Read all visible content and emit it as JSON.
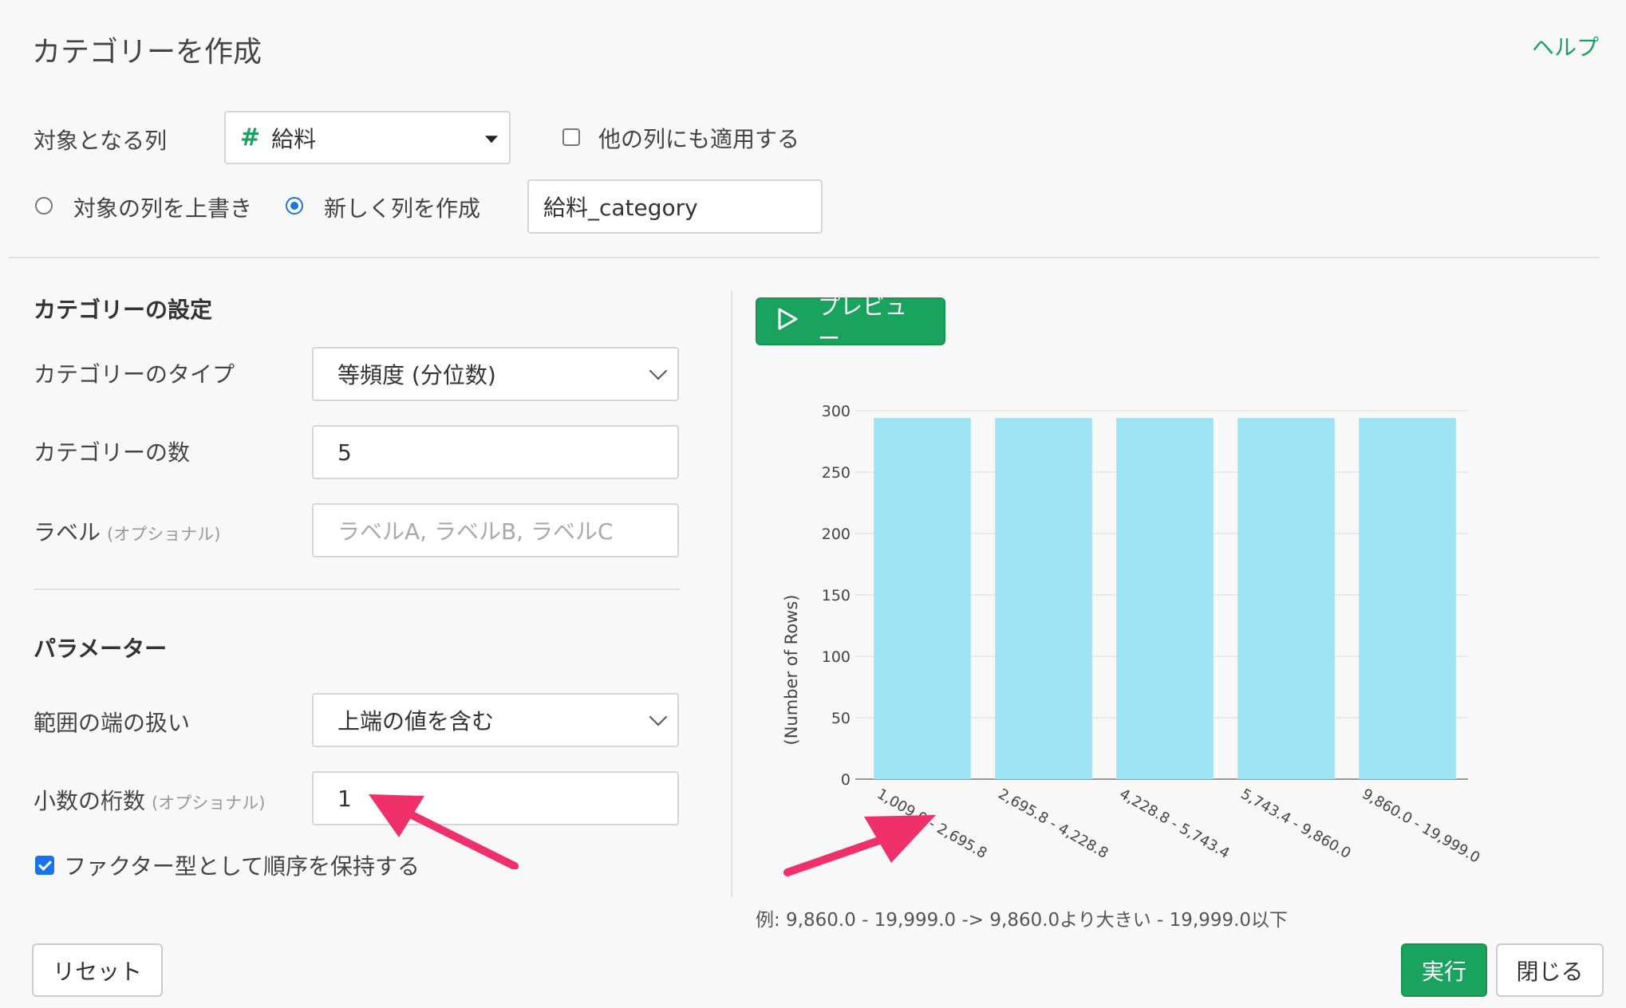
{
  "dialog": {
    "title": "カテゴリーを作成",
    "help": "ヘルプ"
  },
  "target": {
    "label": "対象となる列",
    "column": "給料",
    "column_type_icon": "#",
    "apply_other": "他の列にも適用する",
    "overwrite": "対象の列を上書き",
    "new_column": "新しく列を作成",
    "new_column_name": "給料_category",
    "mode_selected": "new_column"
  },
  "category_settings": {
    "heading": "カテゴリーの設定",
    "type_label": "カテゴリーのタイプ",
    "type_value": "等頻度 (分位数)",
    "count_label": "カテゴリーの数",
    "count_value": "5",
    "labels_label": "ラベル",
    "labels_optional": "(オプショナル)",
    "labels_placeholder": "ラベルA, ラベルB, ラベルC"
  },
  "parameters": {
    "heading": "パラメーター",
    "edge_label": "範囲の端の扱い",
    "edge_value": "上端の値を含む",
    "digits_label": "小数の桁数",
    "digits_optional": "(オプショナル)",
    "digits_value": "1",
    "factor_label": "ファクター型として順序を保持する",
    "factor_checked": true
  },
  "preview": {
    "button": "プレビュー",
    "example": "例: 9,860.0 - 19,999.0 -> 9,860.0より大きい - 19,999.0以下"
  },
  "footer": {
    "reset": "リセット",
    "run": "実行",
    "close": "閉じる"
  },
  "colors": {
    "accent_green": "#1aa35f",
    "bar": "#9de3f3",
    "arrow": "#f0306a",
    "radio_blue": "#1a73e8"
  },
  "chart_data": {
    "type": "bar",
    "categories": [
      "1,009.0 - 2,695.8",
      "2,695.8 - 4,228.8",
      "4,228.8 - 5,743.4",
      "5,743.4 - 9,860.0",
      "9,860.0 - 19,999.0"
    ],
    "values": [
      294,
      294,
      294,
      294,
      294
    ],
    "ylabel": "(Number of Rows)",
    "xlabel": "",
    "ylim": [
      0,
      300
    ],
    "yticks": [
      0,
      50,
      100,
      150,
      200,
      250,
      300
    ],
    "grid": true
  }
}
